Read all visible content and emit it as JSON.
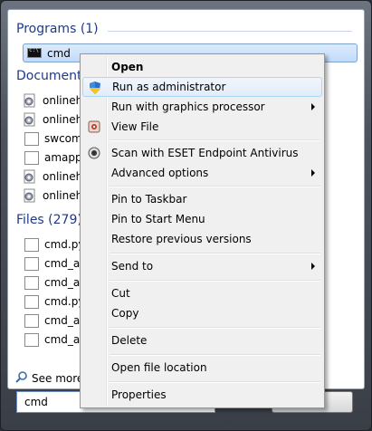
{
  "start_menu": {
    "groups": {
      "programs": {
        "header": "Programs (1)",
        "items": [
          {
            "label": "cmd",
            "icon": "console-icon"
          }
        ]
      },
      "documents": {
        "header": "Documents",
        "items": [
          {
            "label": "onlineh",
            "icon": "gear-document-icon"
          },
          {
            "label": "onlineh",
            "icon": "gear-document-icon"
          },
          {
            "label": "swcom",
            "icon": "document-icon"
          },
          {
            "label": "amapp.",
            "icon": "document-icon"
          },
          {
            "label": "onlineh",
            "icon": "gear-document-icon"
          },
          {
            "label": "onlineh",
            "icon": "gear-document-icon"
          }
        ]
      },
      "files": {
        "header": "Files (279)",
        "items": [
          {
            "label": "cmd.py",
            "icon": "document-icon"
          },
          {
            "label": "cmd_ap",
            "icon": "document-icon"
          },
          {
            "label": "cmd_ap",
            "icon": "document-icon"
          },
          {
            "label": "cmd.py",
            "icon": "document-icon"
          },
          {
            "label": "cmd_ap",
            "icon": "document-icon"
          },
          {
            "label": "cmd_ap",
            "icon": "document-icon"
          }
        ]
      }
    },
    "see_more": "See more",
    "search_value": "cmd"
  },
  "context_menu": {
    "items": [
      {
        "label": "Open",
        "bold": true
      },
      {
        "label": "Run as administrator",
        "icon": "uac-shield-icon",
        "hover": true
      },
      {
        "label": "Run with graphics processor",
        "submenu": true
      },
      {
        "label": "View File",
        "icon": "view-file-icon"
      },
      {
        "separator": true
      },
      {
        "label": "Scan with ESET Endpoint Antivirus",
        "icon": "eset-icon"
      },
      {
        "label": "Advanced options",
        "submenu": true
      },
      {
        "separator": true
      },
      {
        "label": "Pin to Taskbar"
      },
      {
        "label": "Pin to Start Menu"
      },
      {
        "label": "Restore previous versions"
      },
      {
        "separator": true
      },
      {
        "label": "Send to",
        "submenu": true
      },
      {
        "separator": true
      },
      {
        "label": "Cut"
      },
      {
        "label": "Copy"
      },
      {
        "separator": true
      },
      {
        "label": "Delete"
      },
      {
        "separator": true
      },
      {
        "label": "Open file location"
      },
      {
        "separator": true
      },
      {
        "label": "Properties"
      }
    ]
  },
  "colors": {
    "group_header": "#1e3a8a",
    "selection": "#c1dbfc",
    "menu_bg": "#f0f0f0"
  }
}
